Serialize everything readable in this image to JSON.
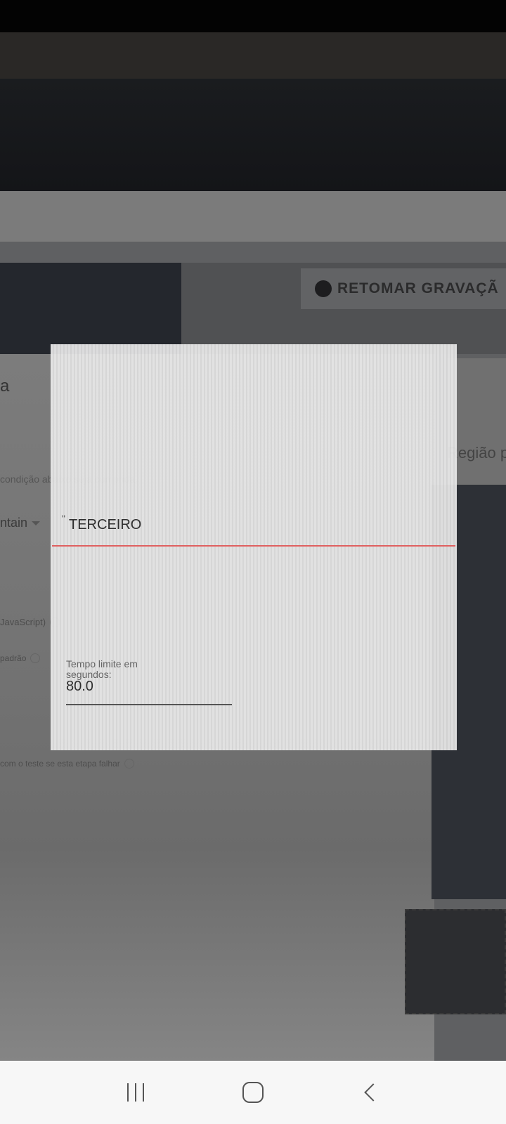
{
  "header": {
    "resume_recording_label": "RETOMAR GRAVAÇÃ"
  },
  "left_panel": {
    "partial_title": "a",
    "condition_text": "condição abaixo seja cumprida.",
    "match_select_value": "ntain",
    "javascript_label": "JavaScript)",
    "default_label": "padrão",
    "fail_text": "com o teste se esta etapa falhar"
  },
  "dialog": {
    "value_input": "TERCEIRO",
    "quote_prefix": "\"",
    "timeout_label": "Tempo limite em segundos:",
    "timeout_value": "80.0"
  },
  "right_panel": {
    "region_label": "Região p"
  },
  "nav_bar": {
    "icons": [
      "recents-icon",
      "home-icon",
      "back-icon"
    ]
  },
  "colors": {
    "accent_underline": "#e06060",
    "nav_background": "#f7f7f7"
  }
}
